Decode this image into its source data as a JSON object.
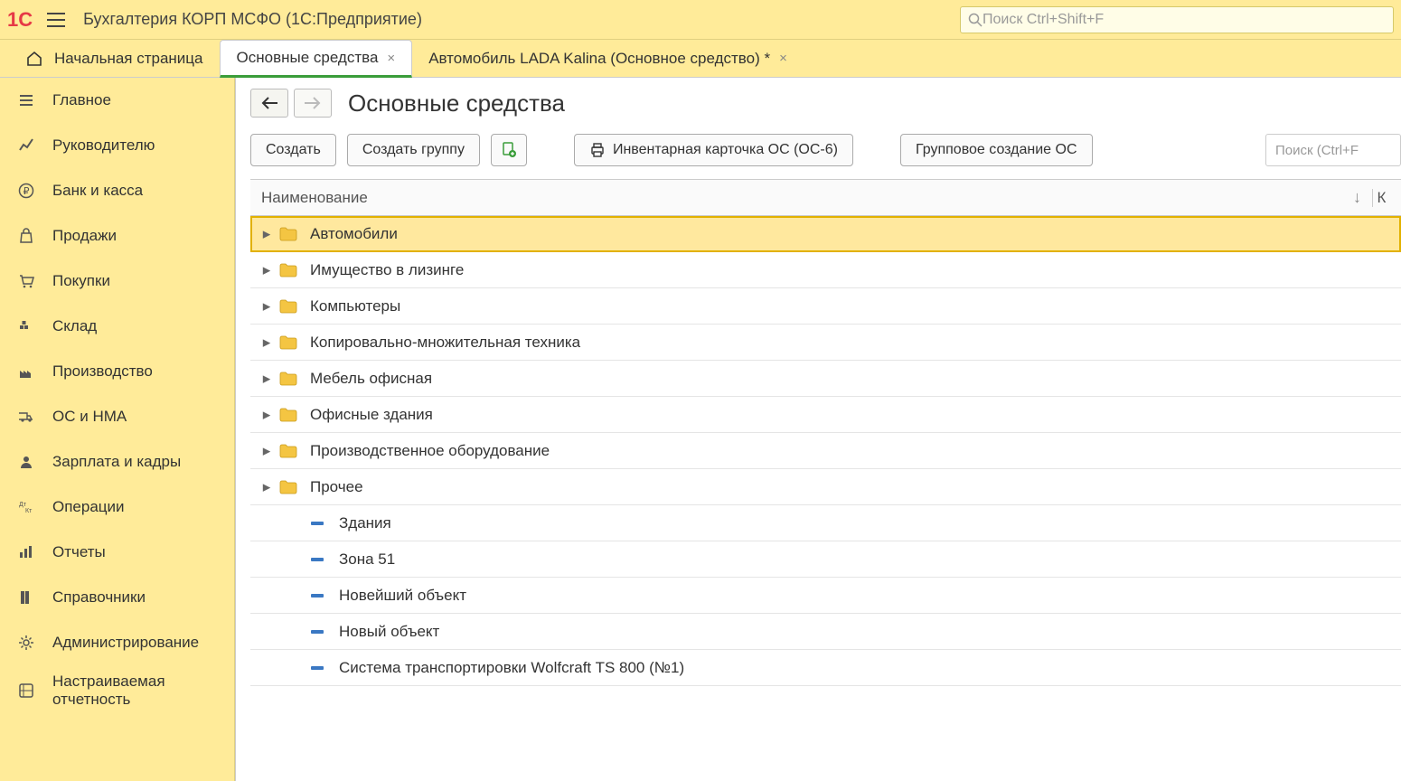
{
  "topbar": {
    "app_title": "Бухгалтерия КОРП МСФО  (1С:Предприятие)",
    "search_placeholder": "Поиск Ctrl+Shift+F"
  },
  "tabs": [
    {
      "label": "Начальная страница",
      "home": true,
      "closable": false,
      "active": false
    },
    {
      "label": "Основные средства",
      "home": false,
      "closable": true,
      "active": true
    },
    {
      "label": "Автомобиль LADA Kalina (Основное средство) *",
      "home": false,
      "closable": true,
      "active": false
    }
  ],
  "sidebar": [
    {
      "icon": "menu",
      "label": "Главное"
    },
    {
      "icon": "trend",
      "label": "Руководителю"
    },
    {
      "icon": "ruble",
      "label": "Банк и касса"
    },
    {
      "icon": "bag",
      "label": "Продажи"
    },
    {
      "icon": "cart",
      "label": "Покупки"
    },
    {
      "icon": "warehouse",
      "label": "Склад"
    },
    {
      "icon": "factory",
      "label": "Производство"
    },
    {
      "icon": "truck",
      "label": "ОС и НМА"
    },
    {
      "icon": "person",
      "label": "Зарплата и кадры"
    },
    {
      "icon": "ops",
      "label": "Операции"
    },
    {
      "icon": "chart",
      "label": "Отчеты"
    },
    {
      "icon": "books",
      "label": "Справочники"
    },
    {
      "icon": "gear",
      "label": "Администрирование"
    },
    {
      "icon": "dynamic",
      "label": "Настраиваемая\nотчетность",
      "multi": true
    }
  ],
  "page": {
    "title": "Основные средства"
  },
  "toolbar": {
    "create": "Создать",
    "create_group": "Создать группу",
    "inventory_card": "Инвентарная карточка ОС (ОС-6)",
    "group_create_os": "Групповое создание ОС",
    "search_placeholder": "Поиск (Ctrl+F"
  },
  "table": {
    "column_name": "Наименование",
    "sort_indicator": "↓",
    "col_last": "К",
    "rows": [
      {
        "type": "folder",
        "label": "Автомобили",
        "selected": true
      },
      {
        "type": "folder",
        "label": "Имущество в лизинге"
      },
      {
        "type": "folder",
        "label": "Компьютеры"
      },
      {
        "type": "folder",
        "label": "Копировально-множительная техника"
      },
      {
        "type": "folder",
        "label": "Мебель офисная"
      },
      {
        "type": "folder",
        "label": "Офисные здания"
      },
      {
        "type": "folder",
        "label": "Производственное оборудование"
      },
      {
        "type": "folder",
        "label": "Прочее"
      },
      {
        "type": "item",
        "label": "Здания"
      },
      {
        "type": "item",
        "label": "Зона 51"
      },
      {
        "type": "item",
        "label": "Новейший объект"
      },
      {
        "type": "item",
        "label": "Новый объект"
      },
      {
        "type": "item",
        "label": "Система транспортировки Wolfcraft TS 800 (№1)"
      }
    ]
  }
}
